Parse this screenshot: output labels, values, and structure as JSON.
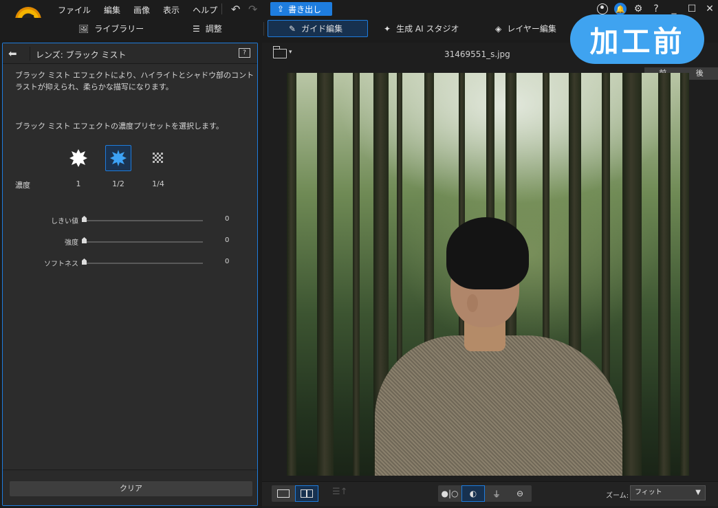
{
  "menu": [
    "ファイル",
    "編集",
    "画像",
    "表示",
    "ヘルプ"
  ],
  "export_label": "書き出し",
  "window_icons": {
    "help": "?",
    "minimize": "_",
    "maximize": "☐",
    "close": "✕"
  },
  "modes": [
    {
      "label": "ライブラリー",
      "icon": "image-icon"
    },
    {
      "label": "調整",
      "icon": "sliders-icon"
    },
    {
      "label": "ガイド編集",
      "icon": "wand-icon",
      "active": true
    },
    {
      "label": "生成 AI スタジオ",
      "icon": "sparkle-icon"
    },
    {
      "label": "レイヤー編集",
      "icon": "layers-icon"
    }
  ],
  "panel": {
    "title": "レンズ: ブラック ミスト",
    "description": "ブラック ミスト エフェクトにより、ハイライトとシャドウ部のコントラストが抑えられ、柔らかな描写になります。",
    "preset_prompt": "ブラック ミスト エフェクトの濃度プリセットを選択します。",
    "density_label": "濃度",
    "presets": [
      {
        "label": "1",
        "selected": false
      },
      {
        "label": "1/2",
        "selected": true
      },
      {
        "label": "1/4",
        "selected": false
      }
    ],
    "sliders": [
      {
        "label": "しきい値",
        "value": "0"
      },
      {
        "label": "強度",
        "value": "0"
      },
      {
        "label": "ソフトネス",
        "value": "0"
      }
    ],
    "clear_label": "クリア"
  },
  "viewer": {
    "filename": "31469551_s.jpg",
    "before_label": "前",
    "after_label": "後",
    "watermark": "加工前",
    "zoom_label": "ズーム:",
    "zoom_value": "フィット"
  },
  "colors": {
    "accent": "#1e7ddf",
    "watermark": "#3fa3f0"
  }
}
